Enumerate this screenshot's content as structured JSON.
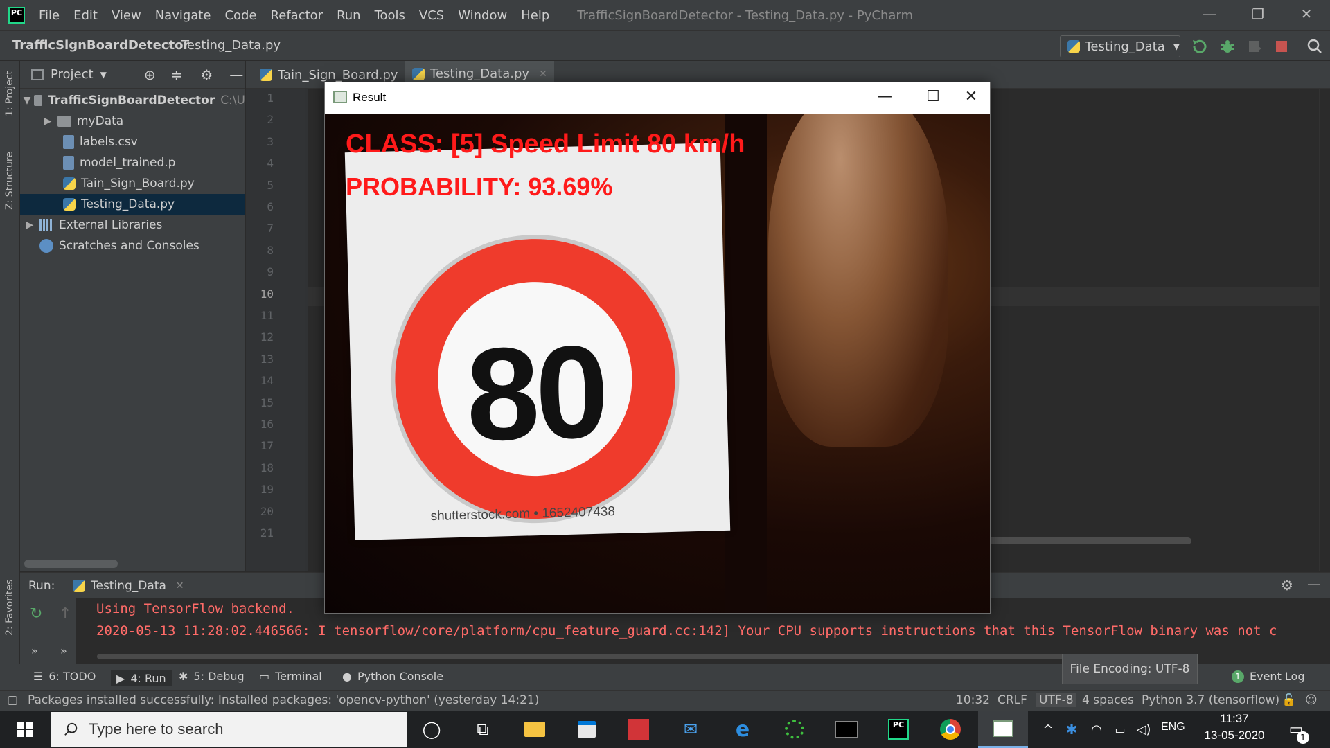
{
  "app": {
    "logo": "PC",
    "window_title": "TrafficSignBoardDetector - Testing_Data.py - PyCharm"
  },
  "menu": [
    "File",
    "Edit",
    "View",
    "Navigate",
    "Code",
    "Refactor",
    "Run",
    "Tools",
    "VCS",
    "Window",
    "Help"
  ],
  "breadcrumb": {
    "project": "TrafficSignBoardDetector",
    "file": "Testing_Data.py"
  },
  "run_config": {
    "label": "Testing_Data"
  },
  "left_strip": {
    "project": "1: Project",
    "structure": "Z: Structure",
    "favorites": "2: Favorites"
  },
  "project_panel": {
    "title": "Project",
    "root": {
      "name": "TrafficSignBoardDetector",
      "path": "C:\\U"
    },
    "items": [
      {
        "label": "myData",
        "type": "folder"
      },
      {
        "label": "labels.csv",
        "type": "file"
      },
      {
        "label": "model_trained.p",
        "type": "file"
      },
      {
        "label": "Tain_Sign_Board.py",
        "type": "python"
      },
      {
        "label": "Testing_Data.py",
        "type": "python",
        "selected": true
      },
      {
        "label": "External Libraries",
        "type": "library"
      },
      {
        "label": "Scratches and Consoles",
        "type": "scratch"
      }
    ]
  },
  "editor": {
    "tabs": [
      {
        "label": "Tain_Sign_Board.py",
        "active": false
      },
      {
        "label": "Testing_Data.py",
        "active": true
      }
    ],
    "line_numbers": [
      "1",
      "2",
      "3",
      "4",
      "5",
      "6",
      "7",
      "8",
      "9",
      "10",
      "11",
      "12",
      "13",
      "14",
      "15",
      "16",
      "17",
      "18",
      "19",
      "20",
      "21"
    ],
    "current_line": "10"
  },
  "result_window": {
    "title": "Result",
    "overlay_class": "CLASS:  [5] Speed Limit 80 km/h",
    "overlay_probability": "PROBABILITY: 93.69%",
    "sign_number": "80",
    "watermark": "shutterstock.com • 1652407438"
  },
  "run_panel": {
    "label": "Run:",
    "tab": "Testing_Data",
    "console": [
      "Using TensorFlow backend.",
      "2020-05-13 11:28:02.446566: I tensorflow/core/platform/cpu_feature_guard.cc:142] Your CPU supports instructions that this TensorFlow binary was not c"
    ]
  },
  "tool_tabs": {
    "todo": "6: TODO",
    "run": "4: Run",
    "debug": "5: Debug",
    "terminal": "Terminal",
    "python_console": "Python Console",
    "event_log": "Event Log",
    "event_count": "1",
    "tooltip": "File Encoding: UTF-8"
  },
  "status": {
    "message": "Packages installed successfully: Installed packages: 'opencv-python' (yesterday 14:21)",
    "position": "10:32",
    "line_sep": "CRLF",
    "encoding": "UTF-8",
    "indent": "4 spaces",
    "interpreter": "Python 3.7 (tensorflow)"
  },
  "taskbar": {
    "search_placeholder": "Type here to search",
    "language": "ENG",
    "time": "11:37",
    "date": "13-05-2020",
    "notification_count": "1"
  },
  "colors": {
    "accent": "#4a88c7",
    "error_text": "#ff6b68",
    "overlay_red": "#ff1a1a",
    "sign_red": "#ef3b2c"
  }
}
